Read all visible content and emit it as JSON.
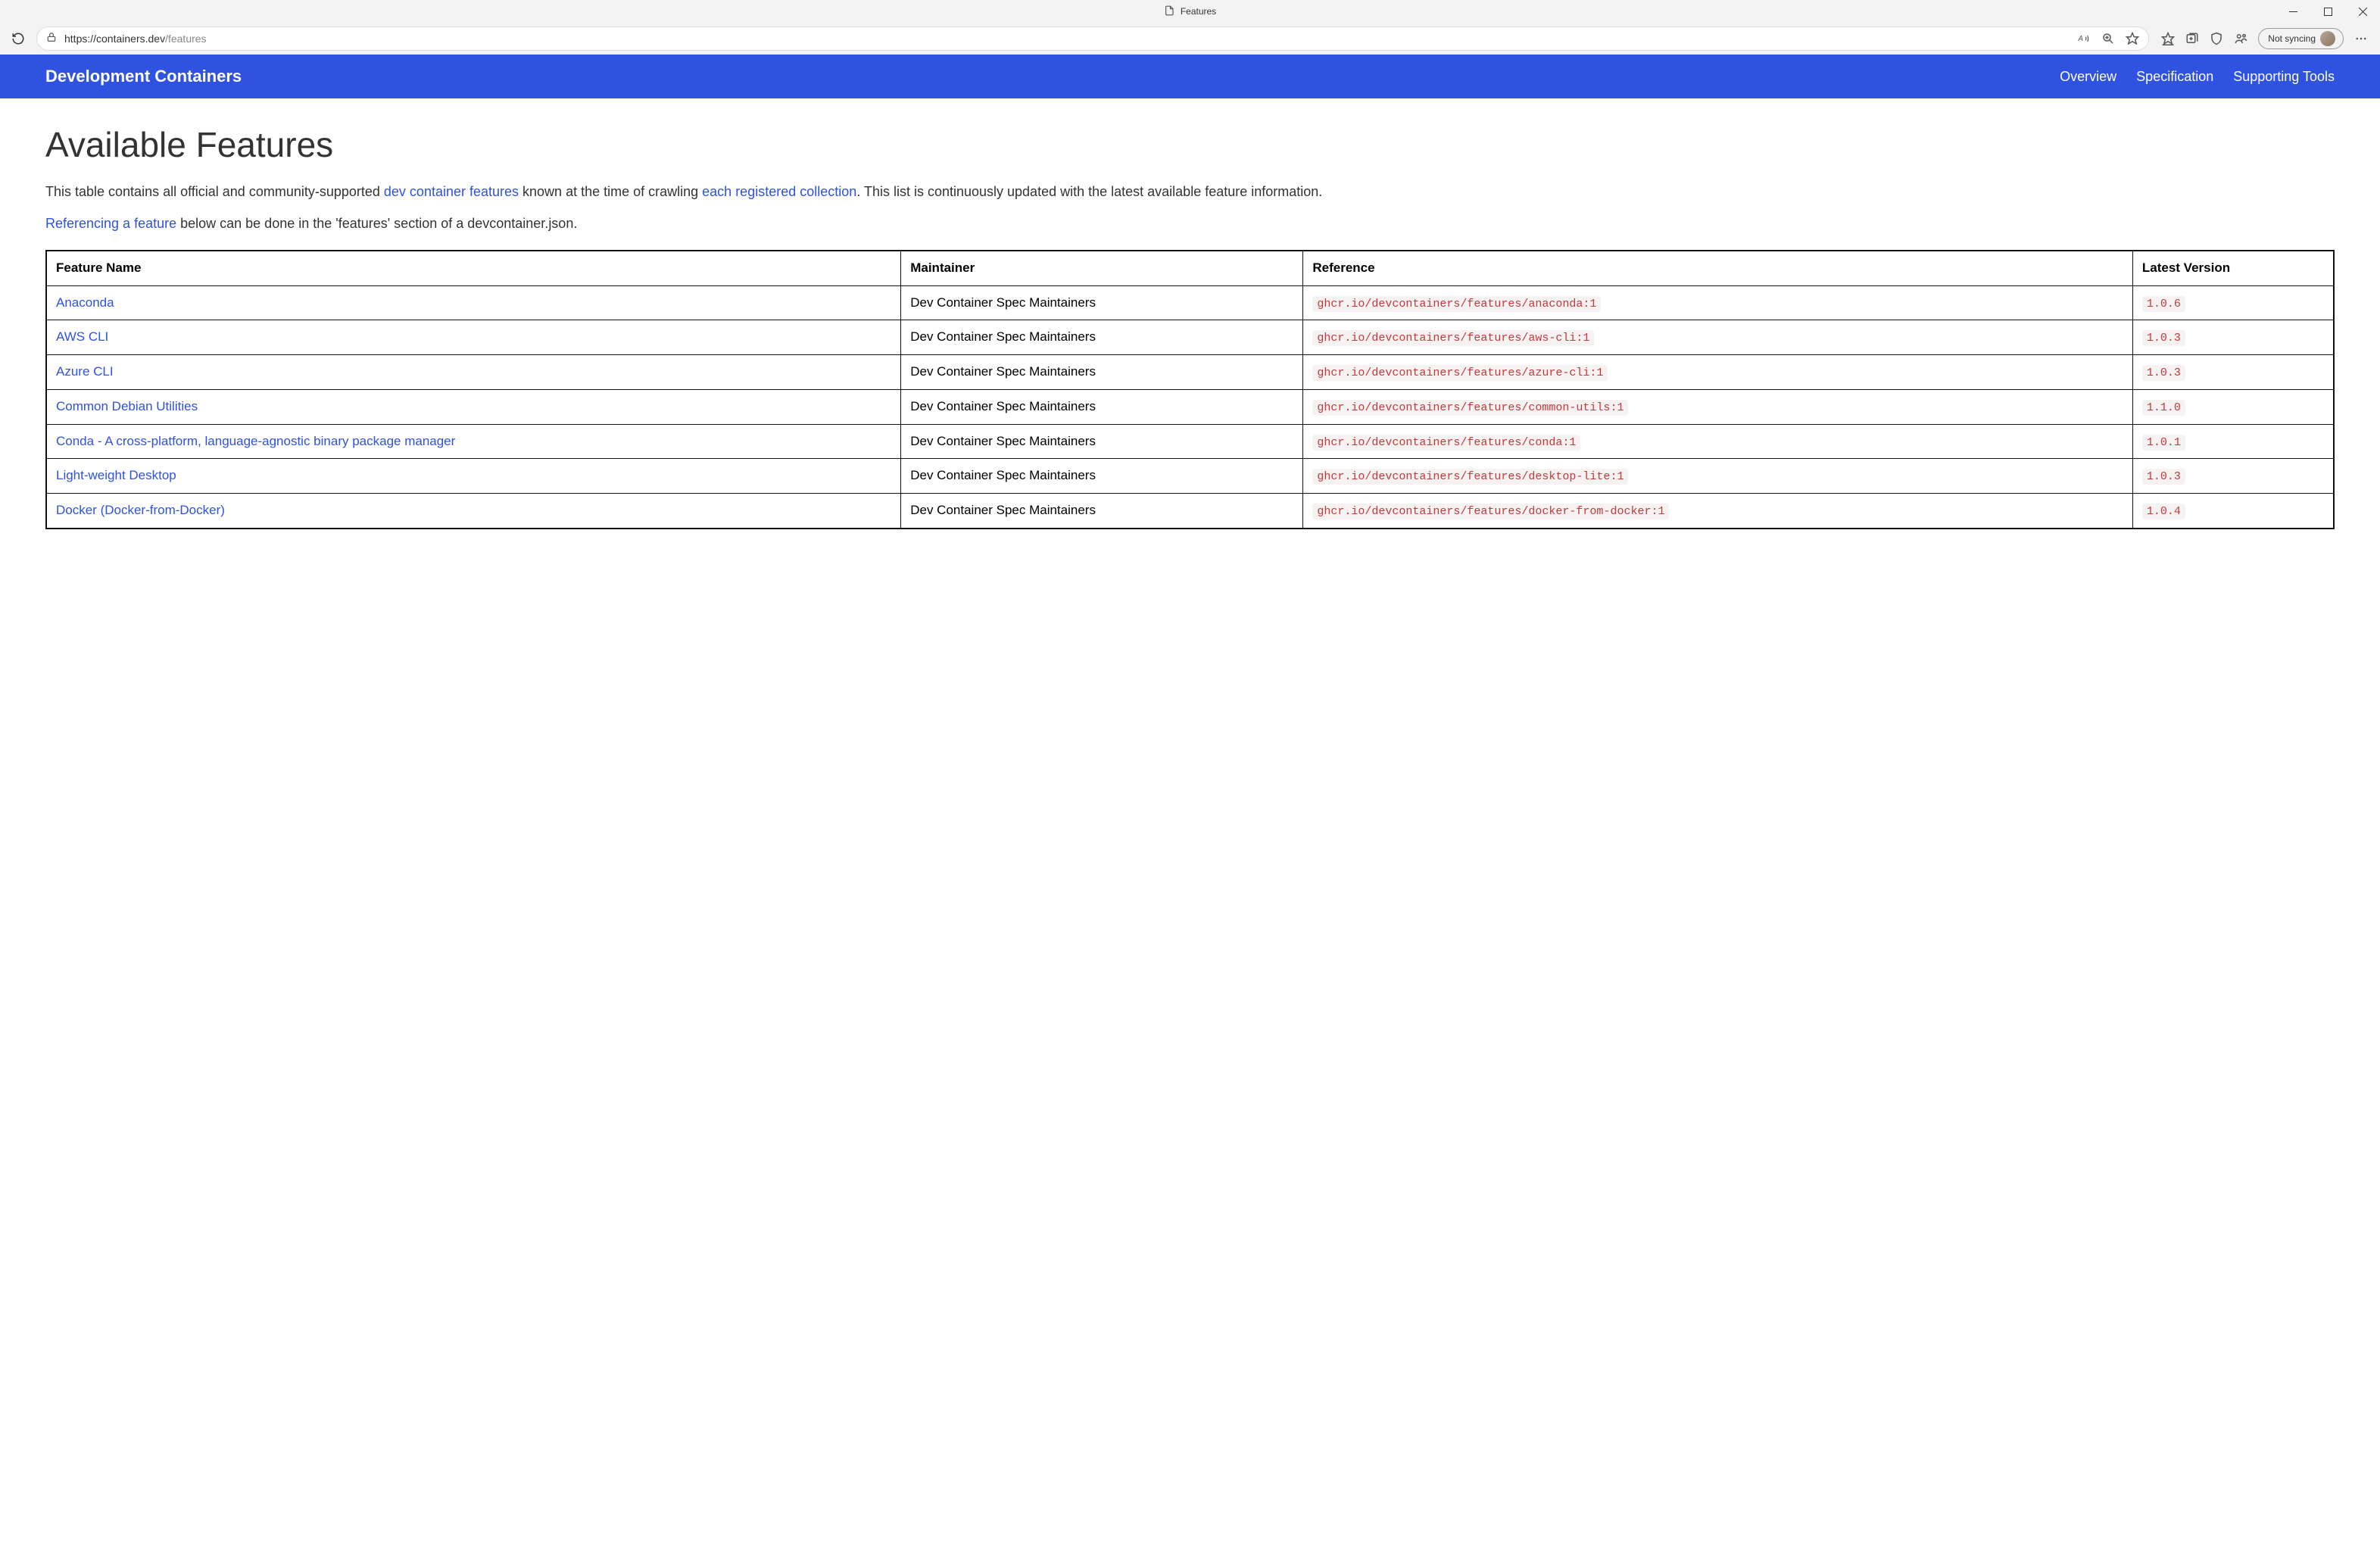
{
  "window": {
    "tab_title": "Features"
  },
  "toolbar": {
    "url_host": "https://containers.dev",
    "url_path": "/features",
    "sync_label": "Not syncing"
  },
  "site": {
    "brand": "Development Containers",
    "nav": [
      "Overview",
      "Specification",
      "Supporting Tools"
    ]
  },
  "page": {
    "heading": "Available Features",
    "intro_pre": "This table contains all official and community-supported ",
    "intro_link1": "dev container features",
    "intro_mid": " known at the time of crawling ",
    "intro_link2": "each registered collection",
    "intro_post": ". This list is continuously updated with the latest available feature information.",
    "ref_link": "Referencing a feature",
    "ref_text": " below can be done in the 'features' section of a devcontainer.json."
  },
  "table": {
    "headers": [
      "Feature Name",
      "Maintainer",
      "Reference",
      "Latest Version"
    ],
    "rows": [
      {
        "name": "Anaconda",
        "maintainer": "Dev Container Spec Maintainers",
        "ref": "ghcr.io/devcontainers/features/anaconda:1",
        "ver": "1.0.6"
      },
      {
        "name": "AWS CLI",
        "maintainer": "Dev Container Spec Maintainers",
        "ref": "ghcr.io/devcontainers/features/aws-cli:1",
        "ver": "1.0.3"
      },
      {
        "name": "Azure CLI",
        "maintainer": "Dev Container Spec Maintainers",
        "ref": "ghcr.io/devcontainers/features/azure-cli:1",
        "ver": "1.0.3"
      },
      {
        "name": "Common Debian Utilities",
        "maintainer": "Dev Container Spec Maintainers",
        "ref": "ghcr.io/devcontainers/features/common-utils:1",
        "ver": "1.1.0"
      },
      {
        "name": "Conda - A cross-platform, language-agnostic binary package manager",
        "maintainer": "Dev Container Spec Maintainers",
        "ref": "ghcr.io/devcontainers/features/conda:1",
        "ver": "1.0.1"
      },
      {
        "name": "Light-weight Desktop",
        "maintainer": "Dev Container Spec Maintainers",
        "ref": "ghcr.io/devcontainers/features/desktop-lite:1",
        "ver": "1.0.3"
      },
      {
        "name": "Docker (Docker-from-Docker)",
        "maintainer": "Dev Container Spec Maintainers",
        "ref": "ghcr.io/devcontainers/features/docker-from-docker:1",
        "ver": "1.0.4"
      }
    ]
  }
}
